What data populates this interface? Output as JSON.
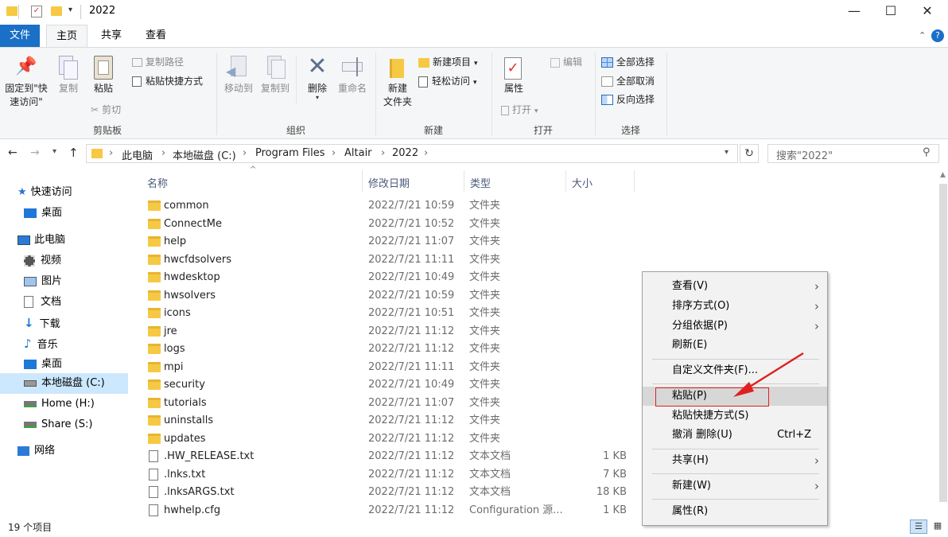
{
  "window": {
    "title": "2022",
    "minimize": "—",
    "maximize": "☐",
    "close": "✕"
  },
  "tabs": [
    "文件",
    "主页",
    "共享",
    "查看"
  ],
  "ribbon": {
    "pin_quick": [
      "固定到\"快",
      "速访问\""
    ],
    "copy": "复制",
    "paste": "粘贴",
    "copy_path": "复制路径",
    "paste_shortcut": "粘贴快捷方式",
    "cut": "剪切",
    "clipboard_group": "剪贴板",
    "move_to": "移动到",
    "copy_to": "复制到",
    "delete": "删除",
    "rename": "重命名",
    "organize_group": "组织",
    "new_folder": [
      "新建",
      "文件夹"
    ],
    "new_item": "新建项目",
    "easy_access": "轻松访问",
    "new_group": "新建",
    "properties": "属性",
    "open": "打开",
    "edit": "编辑",
    "open_group": "打开",
    "select_all": "全部选择",
    "select_none": "全部取消",
    "invert_selection": "反向选择",
    "select_group": "选择"
  },
  "address": {
    "crumbs": [
      "此电脑",
      "本地磁盘 (C:)",
      "Program Files",
      "Altair",
      "2022"
    ],
    "search_placeholder": "搜索\"2022\""
  },
  "nav": {
    "quick_access": "快速访问",
    "desktop1": "桌面",
    "this_pc": "此电脑",
    "videos": "视频",
    "pictures": "图片",
    "documents": "文档",
    "downloads": "下载",
    "music": "音乐",
    "desktop2": "桌面",
    "local_disk": "本地磁盘 (C:)",
    "home": "Home (H:)",
    "share": "Share (S:)",
    "network": "网络"
  },
  "columns": {
    "name": "名称",
    "date": "修改日期",
    "type": "类型",
    "size": "大小"
  },
  "files": [
    {
      "name": "common",
      "date": "2022/7/21 10:59",
      "type": "文件夹",
      "size": ""
    },
    {
      "name": "ConnectMe",
      "date": "2022/7/21 10:52",
      "type": "文件夹",
      "size": ""
    },
    {
      "name": "help",
      "date": "2022/7/21 11:07",
      "type": "文件夹",
      "size": ""
    },
    {
      "name": "hwcfdsolvers",
      "date": "2022/7/21 11:11",
      "type": "文件夹",
      "size": ""
    },
    {
      "name": "hwdesktop",
      "date": "2022/7/21 10:49",
      "type": "文件夹",
      "size": ""
    },
    {
      "name": "hwsolvers",
      "date": "2022/7/21 10:59",
      "type": "文件夹",
      "size": ""
    },
    {
      "name": "icons",
      "date": "2022/7/21 10:51",
      "type": "文件夹",
      "size": ""
    },
    {
      "name": "jre",
      "date": "2022/7/21 11:12",
      "type": "文件夹",
      "size": ""
    },
    {
      "name": "logs",
      "date": "2022/7/21 11:12",
      "type": "文件夹",
      "size": ""
    },
    {
      "name": "mpi",
      "date": "2022/7/21 11:11",
      "type": "文件夹",
      "size": ""
    },
    {
      "name": "security",
      "date": "2022/7/21 10:49",
      "type": "文件夹",
      "size": ""
    },
    {
      "name": "tutorials",
      "date": "2022/7/21 11:07",
      "type": "文件夹",
      "size": ""
    },
    {
      "name": "uninstalls",
      "date": "2022/7/21 11:12",
      "type": "文件夹",
      "size": ""
    },
    {
      "name": "updates",
      "date": "2022/7/21 11:12",
      "type": "文件夹",
      "size": ""
    },
    {
      "name": ".HW_RELEASE.txt",
      "date": "2022/7/21 11:12",
      "type": "文本文档",
      "size": "1 KB"
    },
    {
      "name": ".lnks.txt",
      "date": "2022/7/21 11:12",
      "type": "文本文档",
      "size": "7 KB"
    },
    {
      "name": ".lnksARGS.txt",
      "date": "2022/7/21 11:12",
      "type": "文本文档",
      "size": "18 KB"
    },
    {
      "name": "hwhelp.cfg",
      "date": "2022/7/21 11:12",
      "type": "Configuration 源...",
      "size": "1 KB"
    }
  ],
  "context_menu": {
    "view": "查看(V)",
    "sort": "排序方式(O)",
    "group": "分组依据(P)",
    "refresh": "刷新(E)",
    "customize": "自定义文件夹(F)...",
    "paste": "粘贴(P)",
    "paste_shortcut": "粘贴快捷方式(S)",
    "undo": "撤消 删除(U)",
    "undo_shortcut": "Ctrl+Z",
    "share": "共享(H)",
    "new": "新建(W)",
    "properties": "属性(R)"
  },
  "status": {
    "count": "19 个项目"
  },
  "colors": {
    "accent": "#1a6fc7",
    "folder": "#f6c944",
    "annotation": "#e02020"
  }
}
